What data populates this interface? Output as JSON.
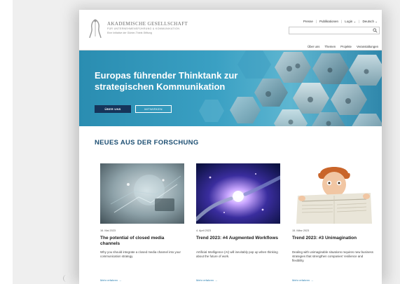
{
  "logo": {
    "title": "AKADEMISCHE GESELLSCHAFT",
    "subtitle": "FÜR UNTERNEHMENSFÜHRUNG & KOMMUNIKATION",
    "tagline": "Eine Initiative der Günter-Thiele-Stiftung"
  },
  "topnav": {
    "items": [
      "Presse",
      "Publikationen",
      "Login",
      "Deutsch"
    ],
    "separator": "|"
  },
  "search": {
    "placeholder": ""
  },
  "mainnav": {
    "items": [
      "Über uns",
      "Themen",
      "Projekte",
      "Veranstaltungen"
    ]
  },
  "hero": {
    "title": "Europas führender Thinktank zur strategischen Kommunikation",
    "primary_button": "ÜBER UNS",
    "secondary_button": "MITWIRKEN"
  },
  "section": {
    "title": "NEUES AUS DER FORSCHUNG"
  },
  "cards": [
    {
      "date": "16. Mai 2023",
      "title": "The potential of closed media channels",
      "text": "Why you should integrate a closed media channel into your communication strategy.",
      "link": "Mehr erfahren →"
    },
    {
      "date": "4. April 2023",
      "title": "Trend 2023: #4 Augmented Workflows",
      "text": "Artificial Intelligence (AI) will inevitably pop up when thinking about the future of work.",
      "link": "Mehr erfahren →"
    },
    {
      "date": "15. März 2023",
      "title": "Trend 2023: #3 Unimagination",
      "text": "Dealing with unimaginable situations requires new business strategies that strengthen companies' resilience and flexibility.",
      "link": "Mehr erfahren →"
    }
  ],
  "colors": {
    "hero": "#3aa0c3",
    "primary_button": "#16345a",
    "section_title": "#1d4f73",
    "link": "#2a7fb0"
  }
}
